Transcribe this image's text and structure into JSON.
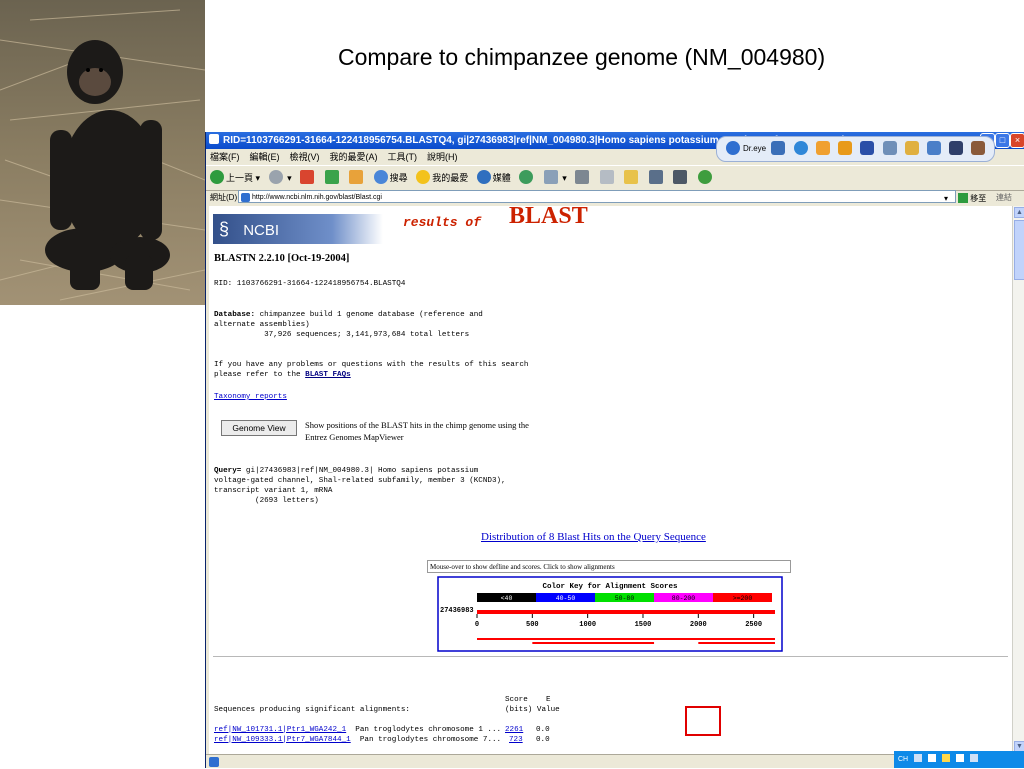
{
  "slide": {
    "title": "Compare to chimpanzee genome (NM_004980)"
  },
  "window": {
    "title": "RID=1103766291-31664-122418956754.BLASTQ4, gi|27436983|ref|NM_004980.3|Homo sapiens potassium v - Microsoft Internet Explorer",
    "controls": [
      "_",
      "□",
      "×"
    ]
  },
  "menu": [
    "檔案(F)",
    "編輯(E)",
    "檢視(V)",
    "我的最愛(A)",
    "工具(T)",
    "說明(H)"
  ],
  "toolbar": {
    "back": "上一頁",
    "search": "搜尋",
    "favorites": "我的最愛",
    "media": "媒體",
    "dreye": "Dr.eye"
  },
  "address": {
    "label": "網址(D)",
    "url": "http://www.ncbi.nlm.nih.gov/blast/Blast.cgi",
    "go": "移至",
    "links": "連結"
  },
  "page": {
    "ncbi_logo": "NCBI",
    "results_of": "results of",
    "blast_word": "BLAST",
    "version": "BLASTN 2.2.10 [Oct-19-2004]",
    "rid": "RID: 1103766291-31664-122418956754.BLASTQ4",
    "database_label": "Database:",
    "database_line1": " chimpanzee build 1 genome database (reference and",
    "database_line2": "alternate assemblies)",
    "database_line3": "           37,926 sequences; 3,141,973,684 total letters",
    "problems_line1": "If you have any problems or questions with the results of this search",
    "problems_line2": "please refer to the ",
    "faq_link": "BLAST FAQs",
    "taxonomy_link": "Taxonomy reports",
    "genome_view_button": "Genome View",
    "genome_view_desc1": "Show positions of the BLAST hits in the chimp genome using the",
    "genome_view_desc2": "Entrez Genomes MapViewer",
    "query_label": "Query=",
    "query_line1": " gi|27436983|ref|NM_004980.3| Homo sapiens potassium",
    "query_line2": "voltage-gated channel, Shal-related subfamily, member 3 (KCND3),",
    "query_line3": "transcript variant 1, mRNA",
    "query_line4": "         (2693 letters)",
    "distribution_title": "Distribution of 8 Blast Hits on the Query Sequence",
    "mouseover_text": "Mouse-over to show defline and scores. Click to show alignments",
    "score_header1": "Score    E",
    "score_header2": "(bits) Value",
    "sequences_label": "Sequences producing significant alignments:"
  },
  "color_key": {
    "title": "Color Key for Alignment Scores",
    "bins": [
      {
        "label": "<40",
        "color": "#000000",
        "text": "#ffffff"
      },
      {
        "label": "40-50",
        "color": "#0000ff",
        "text": "#ffffff"
      },
      {
        "label": "50-80",
        "color": "#00e000",
        "text": "#000000"
      },
      {
        "label": "80-200",
        "color": "#ff00ff",
        "text": "#000000"
      },
      {
        "label": ">=200",
        "color": "#ff0000",
        "text": "#000000"
      }
    ],
    "query_id": "27436983",
    "ticks": [
      "0",
      "500",
      "1000",
      "1500",
      "2000",
      "2500"
    ],
    "query_length": 2693
  },
  "hits": [
    {
      "id": "ref|NW_101731.1|Ptr1_WGA242_1",
      "desc": "Pan troglodytes chromosome 1 ...",
      "score": "2261",
      "evalue": "0.0"
    },
    {
      "id": "ref|NW_109333.1|Ptr7_WGA7844_1",
      "desc": "Pan troglodytes chromosome 7...",
      "score": "723",
      "evalue": "0.0"
    }
  ],
  "hit_bars": [
    {
      "start": 0,
      "end": 2693,
      "color": "#ff0000"
    },
    {
      "start": 500,
      "end": 1600,
      "color": "#ff0000"
    },
    {
      "start": 2000,
      "end": 2693,
      "color": "#ff0000"
    }
  ],
  "status": {
    "tray": "CH"
  }
}
